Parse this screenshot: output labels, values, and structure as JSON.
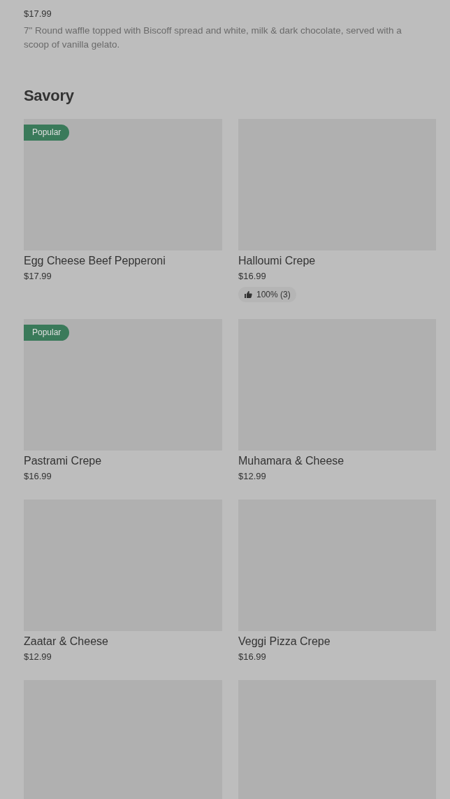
{
  "previous_item": {
    "price": "$17.99",
    "description": "7\" Round waffle topped with Biscoff spread and white, milk & dark chocolate, served with a scoop of vanilla gelato."
  },
  "section": {
    "title": "Savory",
    "items": [
      {
        "kind": "card",
        "badge": "Popular",
        "name": "Egg Cheese Beef Pepperoni",
        "price": "$17.99"
      },
      {
        "kind": "card",
        "name": "Halloumi Crepe",
        "price": "$16.99",
        "rating": "100% (3)"
      },
      {
        "kind": "card",
        "badge": "Popular",
        "name": "Pastrami Crepe",
        "price": "$16.99"
      },
      {
        "kind": "card",
        "name": "Muhamara & Cheese",
        "price": "$12.99"
      },
      {
        "kind": "card",
        "name": "Zaatar & Cheese",
        "price": "$12.99"
      },
      {
        "kind": "card",
        "name": "Veggi Pizza Crepe",
        "price": "$16.99"
      },
      {
        "kind": "cut"
      },
      {
        "kind": "cut"
      }
    ]
  }
}
